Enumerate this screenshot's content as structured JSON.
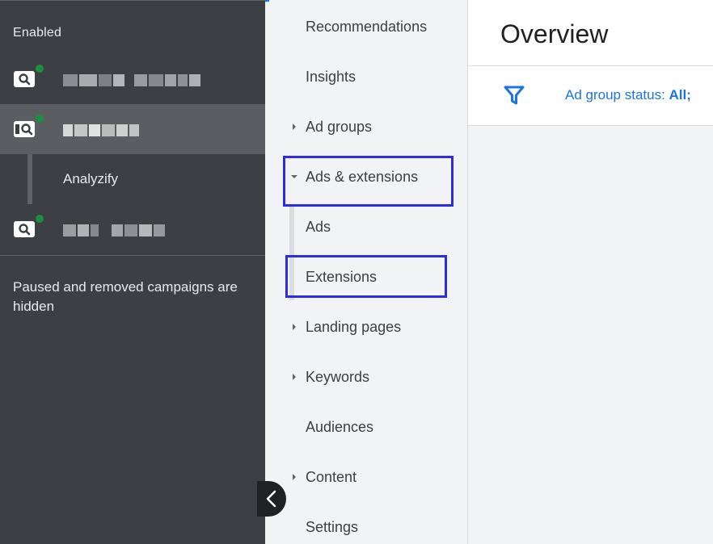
{
  "campaign_panel": {
    "section_label": "Enabled",
    "campaigns": [
      {
        "type_icon": "search-campaign-icon",
        "status": "enabled",
        "name_redacted": true
      },
      {
        "type_icon": "search-campaign-icon",
        "status": "enabled",
        "name_redacted": true,
        "selected": true
      },
      {
        "type_icon": "search-campaign-icon",
        "status": "enabled",
        "name_redacted": true
      }
    ],
    "ad_group": "Analyzify",
    "hidden_note": "Paused and removed campaigns are hidden"
  },
  "nav": {
    "items": [
      {
        "label": "Recommendations",
        "expandable": false
      },
      {
        "label": "Insights",
        "expandable": false
      },
      {
        "label": "Ad groups",
        "expandable": true,
        "expanded": false
      },
      {
        "label": "Ads & extensions",
        "expandable": true,
        "expanded": true,
        "highlighted": true
      },
      {
        "label": "Ads",
        "expandable": false,
        "child": true
      },
      {
        "label": "Extensions",
        "expandable": false,
        "child": true,
        "highlighted": true
      },
      {
        "label": "Landing pages",
        "expandable": true,
        "expanded": false
      },
      {
        "label": "Keywords",
        "expandable": true,
        "expanded": false
      },
      {
        "label": "Audiences",
        "expandable": false
      },
      {
        "label": "Content",
        "expandable": true,
        "expanded": false
      },
      {
        "label": "Settings",
        "expandable": false
      }
    ]
  },
  "content": {
    "title": "Overview",
    "filter": {
      "prefix": "Ad group status: ",
      "value": "All;"
    }
  },
  "colors": {
    "dark_panel": "#3c3f44",
    "selected_row": "#5a5d62",
    "status_green": "#1e8e3e",
    "highlight_box": "#2e2be8",
    "link_blue": "#1a73e8"
  }
}
